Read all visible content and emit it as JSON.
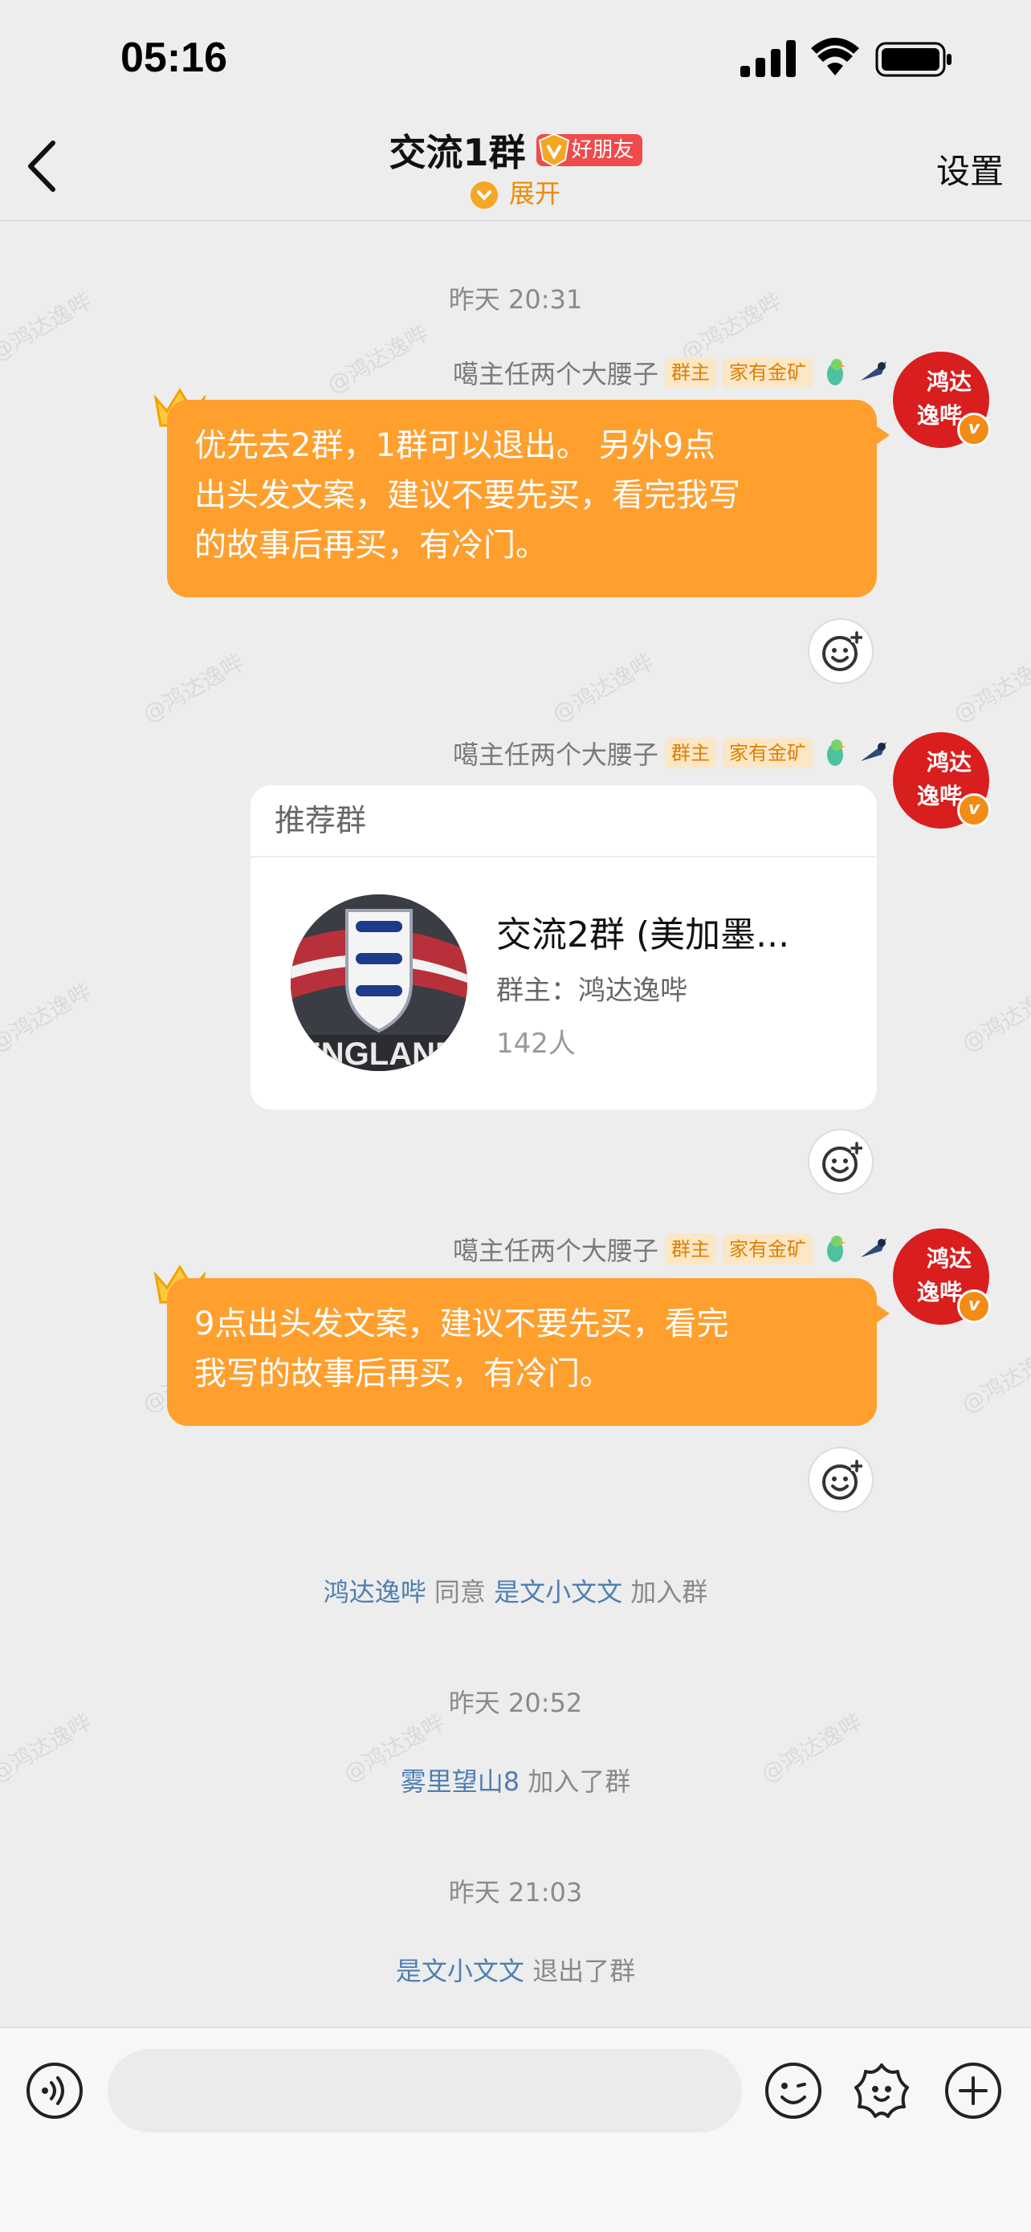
{
  "status": {
    "time": "05:16"
  },
  "nav": {
    "title": "交流1群",
    "friend_badge": "好朋友",
    "expand": "展开",
    "settings": "设置"
  },
  "watermark": "@鸿达逸哔",
  "messages": [
    {
      "timestamp": "昨天 20:31"
    },
    {
      "sender": "噶主任两个大腰子",
      "tags": [
        "群主",
        "家有金矿"
      ],
      "avatar_text": "鸿达逸哔",
      "text_lines": [
        "优先去2群，1群可以退出。 另外9点",
        "出头发文案，建议不要先买，看完我写",
        "的故事后再买，有冷门。"
      ]
    },
    {
      "sender": "噶主任两个大腰子",
      "tags": [
        "群主",
        "家有金矿"
      ],
      "avatar_text": "鸿达逸哔",
      "card": {
        "header": "推荐群",
        "group_name": "交流2群 (美加墨...",
        "owner": "群主：鸿达逸哔",
        "members": "142人",
        "image_text": "ENGLAND"
      }
    },
    {
      "sender": "噶主任两个大腰子",
      "tags": [
        "群主",
        "家有金矿"
      ],
      "avatar_text": "鸿达逸哔",
      "text_lines": [
        "9点出头发文案，建议不要先买，看完",
        "我写的故事后再买，有冷门。"
      ]
    }
  ],
  "system": [
    {
      "user": "鸿达逸哔",
      "mid": "同意",
      "target": "是文小文文",
      "action": "加入群"
    },
    {
      "timestamp": "昨天 20:52"
    },
    {
      "user": "雾里望山8",
      "action": "加入了群"
    },
    {
      "timestamp": "昨天 21:03"
    },
    {
      "user": "是文小文文",
      "action": "退出了群"
    }
  ],
  "colors": {
    "bubble": "#ff9f2e",
    "avatar": "#d81e1e",
    "link": "#4f7fb2",
    "accent": "#f08a00"
  },
  "icons": [
    "voice-icon",
    "emoji-icon",
    "sticker-icon",
    "plus-icon",
    "add-reaction-icon",
    "crown-icon",
    "back-chevron-icon"
  ]
}
